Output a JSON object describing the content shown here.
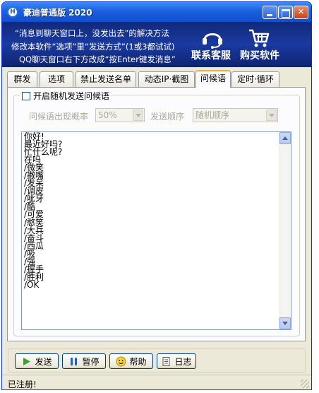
{
  "window": {
    "title": "豪迪普通版 2020",
    "app_icon_letter": "H"
  },
  "banner": {
    "line1": "“消息到聊天窗口上，没发出去”的解决方法",
    "line2": "修改本软件“选项”里“发送方式”(1或3都试试)",
    "line3": "QQ聊天窗口右下方改成“按Enter键发消息”",
    "support_label": "联系客服",
    "buy_label": "购买软件",
    "support_icon": "headset-icon",
    "buy_icon": "shopping-cart-icon"
  },
  "tabs": [
    {
      "label": "群发",
      "active": false
    },
    {
      "label": "选项",
      "active": false
    },
    {
      "label": "禁止发送名单",
      "active": false
    },
    {
      "label": "动态IP·截图",
      "active": false
    },
    {
      "label": "问候语",
      "active": true
    },
    {
      "label": "定时·循环",
      "active": false
    }
  ],
  "greeting": {
    "enable_label": "开启随机发送问候语",
    "enabled": false,
    "probability_label": "问候语出现概率",
    "probability_value": "50%",
    "order_label": "发送顺序",
    "order_value": "随机顺序",
    "lines": [
      "你好!",
      "最近好吗?",
      "忙什么呢?",
      "在吗",
      "/微笑",
      "/撇嘴",
      "/发呆",
      "/调皮",
      "/呲牙",
      "/酷",
      "/可爱",
      "/憨笑",
      "/大兵",
      "/奋斗",
      "/西瓜",
      "/吸",
      "/强",
      "/握手",
      "/胜利",
      "/OK"
    ]
  },
  "buttons": {
    "send": "发送",
    "pause": "暂停",
    "help": "帮助",
    "log": "日志"
  },
  "status": {
    "text": "已注册!"
  },
  "colors": {
    "titlebar": "#1c5fe0",
    "banner": "#1a3aa0",
    "active_tab_accent": "#f8b030",
    "send_icon": "#2fa82f"
  }
}
